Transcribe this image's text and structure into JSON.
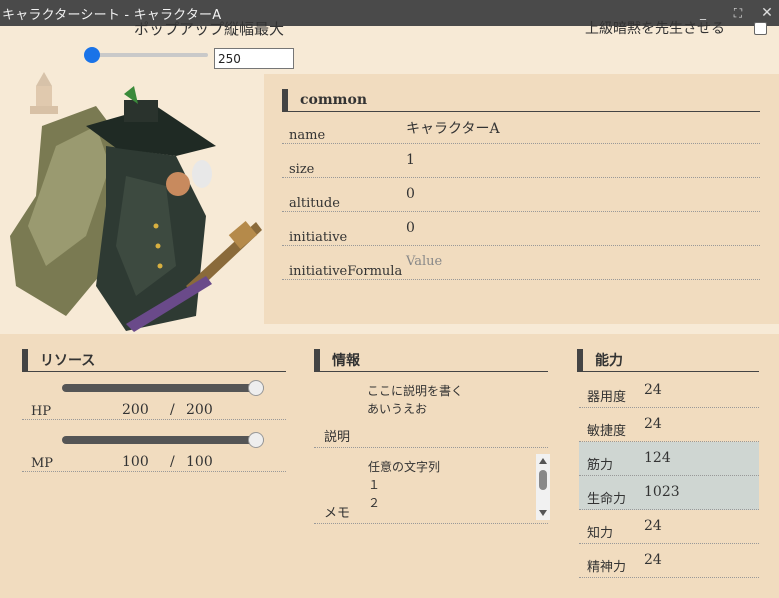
{
  "window": {
    "title": "キャラクターシート - キャラクターA"
  },
  "popup": {
    "label": "ポップアップ縦幅最大",
    "value": "250",
    "slider_fraction": 0.0
  },
  "right_option": {
    "label": "上級暗黙を先生させる",
    "checked": false
  },
  "common": {
    "heading": "common",
    "fields": [
      {
        "key": "name",
        "value": "キャラクターA",
        "placeholder": false
      },
      {
        "key": "size",
        "value": "1",
        "placeholder": false
      },
      {
        "key": "altitude",
        "value": "0",
        "placeholder": false
      },
      {
        "key": "initiative",
        "value": "0",
        "placeholder": false
      },
      {
        "key": "initiativeFormula",
        "value": "Value",
        "placeholder": true
      }
    ]
  },
  "resources": {
    "heading": "リソース",
    "items": [
      {
        "name": "HP",
        "current": "200",
        "slash": "/",
        "max": "200",
        "fill": 1.0
      },
      {
        "name": "MP",
        "current": "100",
        "slash": "/",
        "max": "100",
        "fill": 1.0
      }
    ]
  },
  "info": {
    "heading": "情報",
    "description": {
      "key": "説明",
      "text": "ここに説明を書く\nあいうえお"
    },
    "memo": {
      "key": "メモ",
      "text": "任意の文字列\n１\n２"
    }
  },
  "abilities": {
    "heading": "能力",
    "items": [
      {
        "key": "器用度",
        "value": "24",
        "highlight": false
      },
      {
        "key": "敏捷度",
        "value": "24",
        "highlight": false
      },
      {
        "key": "筋力",
        "value": "124",
        "highlight": true
      },
      {
        "key": "生命力",
        "value": "1023",
        "highlight": true
      },
      {
        "key": "知力",
        "value": "24",
        "highlight": false
      },
      {
        "key": "精神力",
        "value": "24",
        "highlight": false
      }
    ]
  },
  "colors": {
    "titlebar": "#4a4a4a",
    "panel": "#f1dcbf",
    "highlight": "#cfd6d2",
    "slider_accent": "#1a73e8"
  }
}
